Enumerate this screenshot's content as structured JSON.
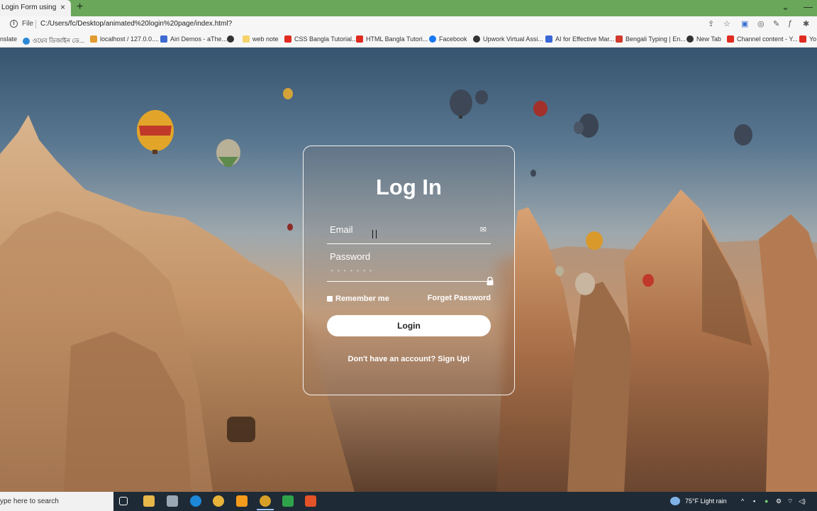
{
  "browser": {
    "tab_title": "Login Form using HTML",
    "tab_close": "×",
    "new_tab": "+",
    "win_minimize": "—",
    "win_chevron": "⌄",
    "scheme": "File",
    "url": "C:/Users/fc/Desktop/animated%20login%20page/index.html?"
  },
  "bookmarks": [
    {
      "label": "nslate",
      "color": "#5f7cc8"
    },
    {
      "label": "ওয়েব ডিজাইন ডে...",
      "color": "#2b8ad6"
    },
    {
      "label": "localhost / 127.0.0....",
      "color": "#e29b2f"
    },
    {
      "label": "Airi Demos - aThe...",
      "color": "#3d6bd1"
    },
    {
      "label": "",
      "color": "#333333"
    },
    {
      "label": "web note",
      "color": "#f5d36a"
    },
    {
      "label": "CSS Bangla Tutorial...",
      "color": "#e02b20"
    },
    {
      "label": "HTML Bangla Tutori...",
      "color": "#e02b20"
    },
    {
      "label": "Facebook",
      "color": "#1877f2"
    },
    {
      "label": "Upwork Virtual Assi...",
      "color": "#333333"
    },
    {
      "label": "AI for Effective Mar...",
      "color": "#3a66d6"
    },
    {
      "label": "Bengali Typing | En...",
      "color": "#d13a2d"
    },
    {
      "label": "New Tab",
      "color": "#333333"
    },
    {
      "label": "Channel content - Y...",
      "color": "#e02b20"
    },
    {
      "label": "Yo",
      "color": "#e02b20"
    }
  ],
  "login": {
    "title": "Log In",
    "email_label": "Email",
    "password_label": "Password",
    "password_mask": "• • • • • • •",
    "remember_label": "Remember me",
    "forget_label": "Forget Password",
    "login_button": "Login",
    "register_text": "Don't have an account? Sign Up!"
  },
  "taskbar": {
    "search_text": "ype here to search",
    "weather": "75°F  Light rain"
  },
  "colors": {
    "tab_strip": "#6aa75b",
    "card_border": "#ffffff",
    "taskbar": "#1e2a36"
  }
}
